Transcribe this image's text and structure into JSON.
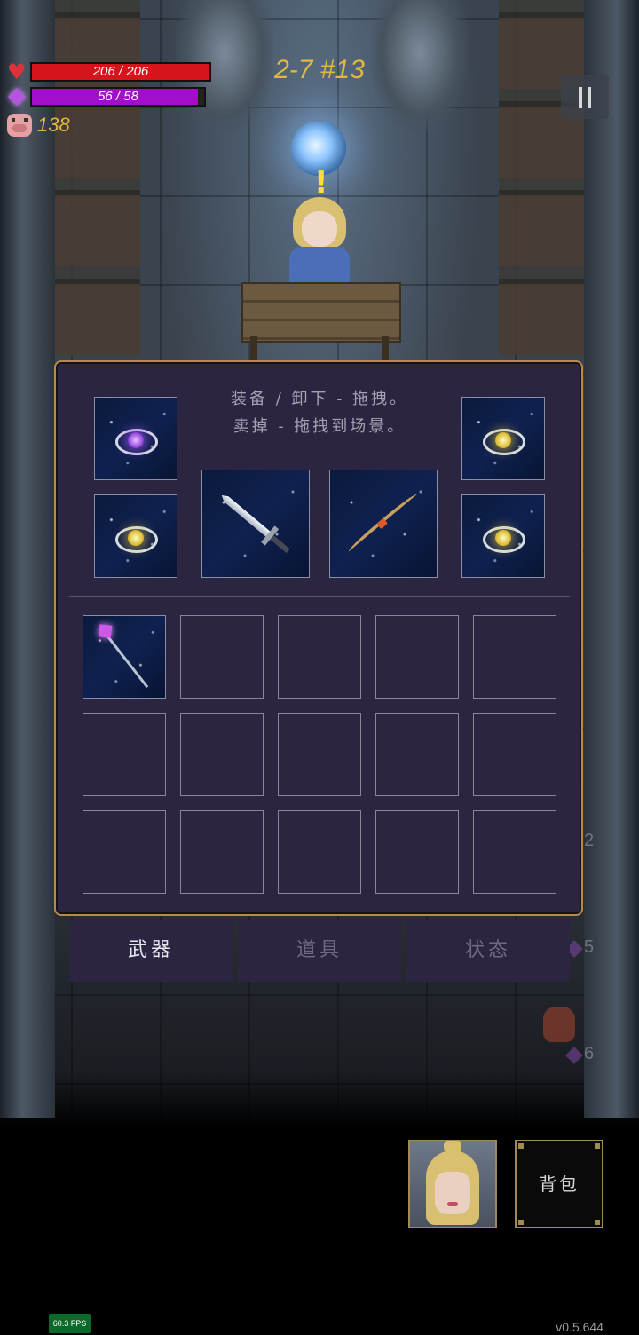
{
  "hud": {
    "hp": {
      "current": 206,
      "max": 206,
      "text": "206 / 206",
      "fill_fraction": 1.0
    },
    "mp": {
      "current": 56,
      "max": 58,
      "text": "56 / 58",
      "fill_fraction": 0.966
    },
    "gold": "138",
    "level": "2-7 #13"
  },
  "equipment_panel": {
    "hint_line1": "装备 / 卸下 - 拖拽。",
    "hint_line2": "卖掉 - 拖拽到场景。",
    "equipped": [
      {
        "slot": "ring-top-left",
        "icon": "purple-ring-icon"
      },
      {
        "slot": "ring-bottom-left",
        "icon": "gold-ring-icon"
      },
      {
        "slot": "weapon-main",
        "icon": "sword-icon"
      },
      {
        "slot": "weapon-offhand",
        "icon": "bow-icon"
      },
      {
        "slot": "ring-top-right",
        "icon": "gold-ring-icon"
      },
      {
        "slot": "ring-bottom-right",
        "icon": "gold-ring-icon"
      }
    ],
    "inventory_rows": 3,
    "inventory_cols": 5,
    "inventory_items": [
      {
        "index": 0,
        "icon": "staff-icon"
      }
    ]
  },
  "tabs": [
    {
      "label": "武器",
      "active": true
    },
    {
      "label": "道具",
      "active": false
    },
    {
      "label": "状态",
      "active": false
    }
  ],
  "side_hints": [
    "2",
    "5",
    "6"
  ],
  "bottom": {
    "bag_label": "背包",
    "fps": "60.3 FPS",
    "version": "v0.5.644"
  },
  "colors": {
    "hp": "#d6141c",
    "mp": "#a10fcb",
    "gold": "#e0b742",
    "panel_bg": "#2b2541",
    "panel_border": "#b98a45"
  }
}
